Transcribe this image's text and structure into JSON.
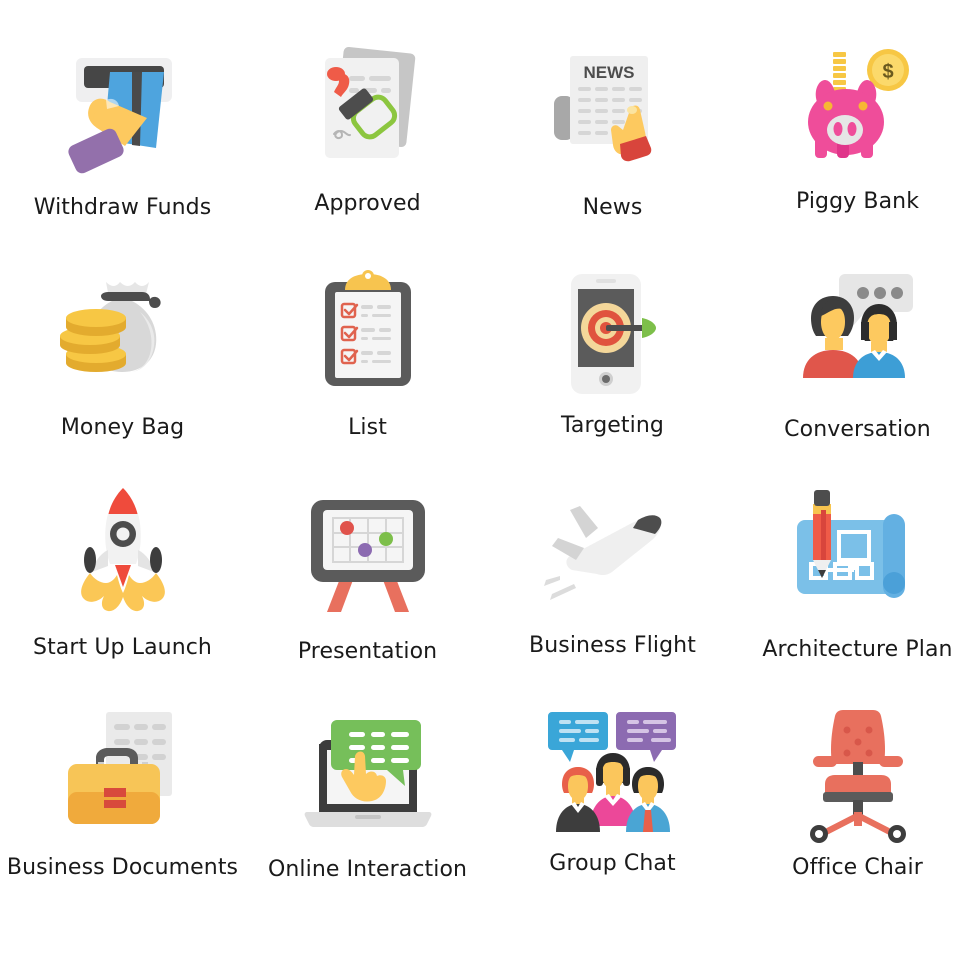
{
  "page": {
    "title": "Business and Finance Flat Icons",
    "background": "#ffffff",
    "label_color": "#1a1a1a",
    "columns": 4,
    "rows": 4
  },
  "icons": [
    {
      "name": "withdraw-funds",
      "label": "Withdraw Funds",
      "glyph": "atm-card-hand-icon",
      "colors": {
        "slot": "#efeff0",
        "slot_dark": "#464646",
        "card": "#4ea4de",
        "stripe": "#4a4a4a",
        "hand": "#fdc95f",
        "sleeve": "#9370ab"
      }
    },
    {
      "name": "approved",
      "label": "Approved",
      "glyph": "approved-stamp-document-icon",
      "colors": {
        "paper": "#f1f1f1",
        "paper_back": "#c6c6c6",
        "stamp_handle": "#ef5b48",
        "stamp_body": "#4d4d4d",
        "mark": "#8cc63f",
        "lines": "#d6d6d6"
      }
    },
    {
      "name": "news",
      "label": "News",
      "glyph": "newspaper-hand-icon",
      "colors": {
        "paper": "#efefef",
        "roll": "#a8a8a8",
        "text": "#4d4d4d",
        "lines": "#d6d6d6",
        "hand": "#fdc95f",
        "sleeve": "#e8453c"
      }
    },
    {
      "name": "piggy-bank",
      "label": "Piggy Bank",
      "glyph": "piggy-bank-coin-icon",
      "colors": {
        "body": "#ef4d9a",
        "body_light": "#f06bb0",
        "snout": "#e6e6e6",
        "coin": "#f7c744",
        "coin_light": "#fbd96b",
        "eye": "#f7b733"
      }
    },
    {
      "name": "money-bag",
      "label": "Money Bag",
      "glyph": "money-bag-coins-icon",
      "colors": {
        "bag": "#d8d8d8",
        "bag_light": "#eaeaea",
        "tie": "#4d4d4d",
        "coin": "#f7c744",
        "coin_edge": "#e3ab2e"
      }
    },
    {
      "name": "list",
      "label": "List",
      "glyph": "clipboard-checklist-icon",
      "colors": {
        "board": "#5b5b5b",
        "paper": "#f5f5f5",
        "clip": "#f7c44f",
        "check": "#e0634f",
        "lines": "#d6d6d6"
      }
    },
    {
      "name": "targeting",
      "label": "Targeting",
      "glyph": "mobile-target-dart-icon",
      "colors": {
        "phone": "#f1f1f1",
        "screen": "#5b5b5b",
        "ring_outer": "#f4d79a",
        "ring_mid": "#e0533e",
        "ring_in": "#f7c744",
        "dart": "#4d4d4d",
        "fletch": "#7dbf4a"
      }
    },
    {
      "name": "conversation",
      "label": "Conversation",
      "glyph": "two-people-speech-bubble-icon",
      "colors": {
        "bubble": "#e6e6e6",
        "dots": "#8a8a8a",
        "hair": "#3d3d3d",
        "skin": "#fdc95f",
        "shirt_red": "#e0564b",
        "shirt_blue": "#3d9ed6"
      }
    },
    {
      "name": "start-up-launch",
      "label": "Start Up Launch",
      "glyph": "rocket-launch-icon",
      "colors": {
        "body": "#f2f2f2",
        "nose": "#ef4b3c",
        "window": "#4d4d4d",
        "fin": "#3d3d3d",
        "flame": "#fbc756",
        "flame_red": "#ef4b3c"
      }
    },
    {
      "name": "presentation",
      "label": "Presentation",
      "glyph": "presentation-board-icon",
      "colors": {
        "frame": "#5b5b5b",
        "screen": "#f5f5f5",
        "grid": "#d6d6d6",
        "legs": "#e8705e",
        "dot_red": "#e0534c",
        "dot_green": "#7dbf4a",
        "dot_purple": "#8c6bb1"
      }
    },
    {
      "name": "business-flight",
      "label": "Business Flight",
      "glyph": "airplane-icon",
      "colors": {
        "body": "#efefef",
        "wing": "#d4d4d4",
        "cockpit": "#4d4d4d",
        "trail": "#dcdcdc"
      }
    },
    {
      "name": "architecture-plan",
      "label": "Architecture Plan",
      "glyph": "blueprint-pencil-icon",
      "colors": {
        "sheet": "#7bc0e8",
        "roll": "#63b0e2",
        "lines": "#ffffff",
        "pencil_body": "#ef5b48",
        "pencil_band": "#f7c44f",
        "pencil_top": "#4d4d4d",
        "pencil_tip": "#3d3d3d"
      }
    },
    {
      "name": "business-documents",
      "label": "Business Documents",
      "glyph": "briefcase-document-icon",
      "colors": {
        "paper": "#eaeaea",
        "lines": "#d2d2d2",
        "case": "#f7c557",
        "case_dark": "#f0aa3c",
        "handle": "#5b5b5b",
        "handle_light": "#cfcfcf",
        "lock": "#d84a3c"
      }
    },
    {
      "name": "online-interaction",
      "label": "Online Interaction",
      "glyph": "laptop-chat-hand-icon",
      "colors": {
        "laptop": "#3d3d3d",
        "base": "#dedede",
        "screen": "#f5f5f5",
        "bubble": "#76bf5a",
        "bubble_lines": "#ffffff",
        "hand": "#fdc95f"
      }
    },
    {
      "name": "group-chat",
      "label": "Group Chat",
      "glyph": "group-chat-people-icon",
      "colors": {
        "bubble_blue": "#3aa6d8",
        "bubble_purple": "#8c6bb1",
        "hair_dark": "#2b2b2b",
        "skin": "#fbc65c",
        "hair_red": "#e8604a",
        "suit_dark": "#3d3d3d",
        "suit_blue": "#4aa5d4",
        "dress_pink": "#ec4899",
        "tie": "#e8604a"
      }
    },
    {
      "name": "office-chair",
      "label": "Office Chair",
      "glyph": "office-chair-icon",
      "colors": {
        "seat": "#e8705e",
        "seat_dark": "#5b5b5b",
        "pole": "#4d4d4d",
        "wheel": "#3d3d3d",
        "button": "#d8574a"
      }
    }
  ]
}
